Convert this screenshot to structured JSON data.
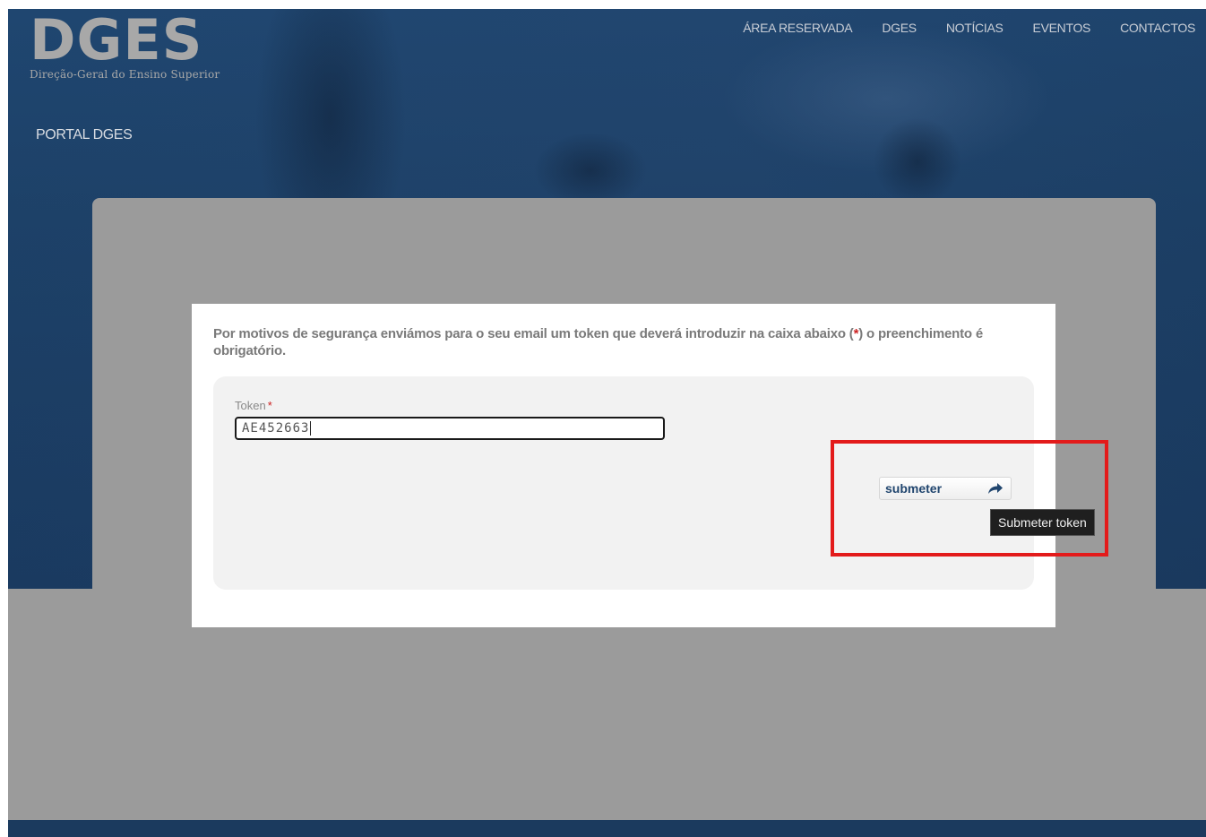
{
  "header": {
    "logo_text": "DGES",
    "logo_subtitle": "Direção-Geral do Ensino Superior",
    "nav": [
      "ÁREA RESERVADA",
      "DGES",
      "NOTÍCIAS",
      "EVENTOS",
      "CONTACTOS"
    ],
    "portal_title": "PORTAL DGES"
  },
  "form": {
    "notice_before": "Por motivos de segurança enviámos para o seu email um token que deverá introduzir na caixa abaixo (",
    "notice_required_mark": "*",
    "notice_after": ") o preenchimento é obrigatório.",
    "token_label": "Token",
    "token_required_mark": "*",
    "token_value": "AE452663",
    "submit_label": "submeter",
    "submit_tooltip": "Submeter token"
  },
  "colors": {
    "header_blue": "#1d4168",
    "highlight_red": "#e31b1b",
    "required_red": "#cc2222"
  }
}
